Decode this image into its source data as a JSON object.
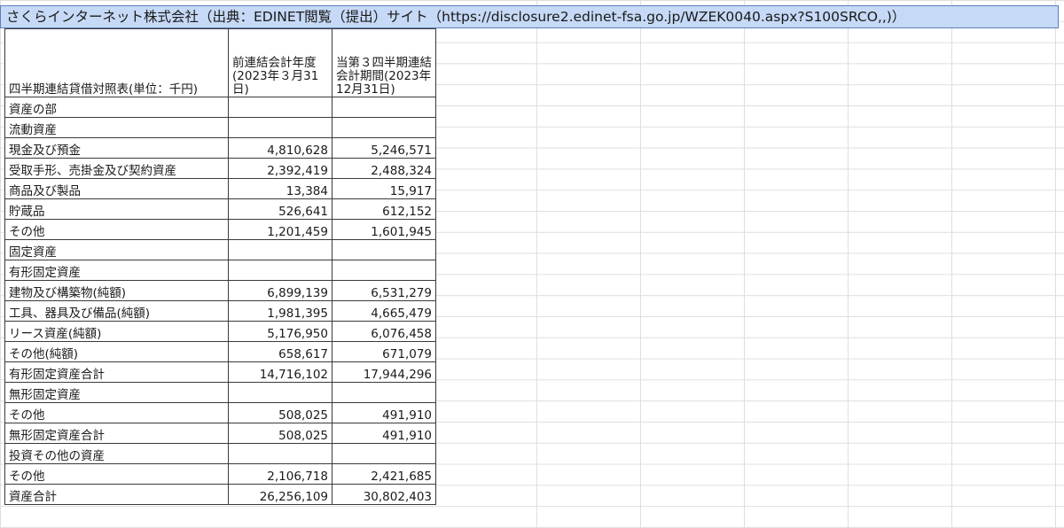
{
  "sheet": {
    "title": "さくらインターネット株式会社（出典：EDINET閲覧（提出）サイト（https://disclosure2.edinet-fsa.go.jp/WZEK0040.aspx?S100SRCO,,)）",
    "header": {
      "label": "四半期連結貸借対照表(単位：千円)",
      "col1": "前連結会計年度(2023年３月31日)",
      "col2": "当第３四半期連結会計期間(2023年12月31日)"
    },
    "rows": [
      {
        "label": "資産の部",
        "prev": "",
        "curr": ""
      },
      {
        "label": "流動資産",
        "prev": "",
        "curr": ""
      },
      {
        "label": "現金及び預金",
        "prev": "4,810,628",
        "curr": "5,246,571"
      },
      {
        "label": "受取手形、売掛金及び契約資産",
        "prev": "2,392,419",
        "curr": "2,488,324"
      },
      {
        "label": "商品及び製品",
        "prev": "13,384",
        "curr": "15,917"
      },
      {
        "label": "貯蔵品",
        "prev": "526,641",
        "curr": "612,152"
      },
      {
        "label": "その他",
        "prev": "1,201,459",
        "curr": "1,601,945"
      },
      {
        "label": "固定資産",
        "prev": "",
        "curr": ""
      },
      {
        "label": "有形固定資産",
        "prev": "",
        "curr": ""
      },
      {
        "label": "建物及び構築物(純額)",
        "prev": "6,899,139",
        "curr": "6,531,279"
      },
      {
        "label": "工具、器具及び備品(純額)",
        "prev": "1,981,395",
        "curr": "4,665,479"
      },
      {
        "label": "リース資産(純額)",
        "prev": "5,176,950",
        "curr": "6,076,458"
      },
      {
        "label": "その他(純額)",
        "prev": "658,617",
        "curr": "671,079"
      },
      {
        "label": "有形固定資産合計",
        "prev": "14,716,102",
        "curr": "17,944,296"
      },
      {
        "label": "無形固定資産",
        "prev": "",
        "curr": ""
      },
      {
        "label": "その他",
        "prev": "508,025",
        "curr": "491,910"
      },
      {
        "label": "無形固定資産合計",
        "prev": "508,025",
        "curr": "491,910"
      },
      {
        "label": "投資その他の資産",
        "prev": "",
        "curr": ""
      },
      {
        "label": "その他",
        "prev": "2,106,718",
        "curr": "2,421,685"
      },
      {
        "label": "資産合計",
        "prev": "26,256,109",
        "curr": "30,802,403"
      }
    ]
  }
}
